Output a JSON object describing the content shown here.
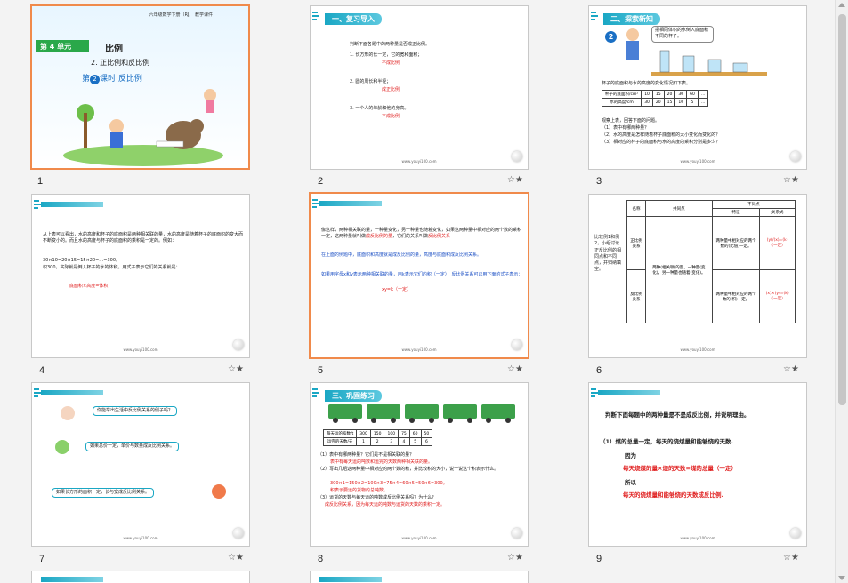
{
  "slides": [
    {
      "num": "1",
      "header": "六年级数学下册（RJ）",
      "header2": "教学课件",
      "unit": "第 4 单元",
      "unit_title": "比例",
      "lesson": "2. 正比例和反比例",
      "period_prefix": "第",
      "period_num": "2",
      "period_suffix": "课时  反比例"
    },
    {
      "num": "2",
      "title": "一、复习导入",
      "intro": "判断下面各题中的两种量是否成正比例。",
      "q1": "1. 长方形的长一定，它的宽和面积；",
      "a1": "不成比例",
      "q2": "2. 圆的周长和半径；",
      "a2": "成正比例",
      "q3": "3. 一个人的年龄和他的身高。",
      "a3": "不成比例",
      "url": "www.youyi100.com"
    },
    {
      "num": "3",
      "title": "二、探索新知",
      "badge": "2",
      "bubble": "把相同体积的水倒入底面积不同的杯子。",
      "caption": "杯子的底面积与水的高度的变化情况如下表。",
      "row1_label": "杯子的底面积/cm²",
      "row1": [
        "10",
        "15",
        "20",
        "30",
        "60",
        "…"
      ],
      "row2_label": "水的高度/cm",
      "row2": [
        "30",
        "20",
        "15",
        "10",
        "5",
        "…"
      ],
      "lead": "观察上表，回答下面的问题。",
      "questions": [
        "（1）表中有哪两种量？",
        "（2）水的高度是怎样随着杯子底面积的大小变化而变化的？",
        "（3）相对应的杯子的底面积与水的高度的乘积分别是多少？"
      ],
      "url": "www.youyi100.com"
    },
    {
      "num": "4",
      "para": "从上表可以看出，水的高度和杯子的底面积是两种相关联的量，水的高度是随着杯子的底面积的变大而不断变小的。而且水的高度与杯子的底面积的乘积是一定的。例如：",
      "calc": "30×10=20×15=15×20=…=300。",
      "para2": "积300，实际就是倒入杯子的水的体积。用式子表示它们的关系就是：",
      "formula": "底面积×高度=体积",
      "url": "www.youyi100.com"
    },
    {
      "num": "5",
      "p1": "像这样，两种相关联的量，一种量变化，另一种量也随着变化，如果这两种量中相对应的两个数的乘积一定，这两种量就叫做",
      "p1_red": "成反比例的量",
      "p1_end": "，它们的关系叫做",
      "p1_red2": "反比例关系",
      "p2": "在上面的例题中，底面积和高度就是成反比例的量，高度与底面积成反比例关系。",
      "p3": "如果用字母x和y表示两种相关联的量，用k表示它们的积（一定），反比例关系可以用下面的式子表示：",
      "formula": "xy=k（一定）",
      "url": "www.youyi100.com"
    },
    {
      "num": "6",
      "side": "比较例1和例2，小组讨论正反比例的相同点和不同点，并归纳填空。",
      "h_name": "名称",
      "h_same": "共同点",
      "h_diff": "不同点",
      "h_feat": "特征",
      "h_rel": "关系式",
      "r1_name": "正比例关系",
      "same": "两种(相关联)的量，一种量(变化)，另一种量也随着(变化)。",
      "r1_feat": "两种量中相对应的两个数的(比值)一定。",
      "r1_rel": "(y)/(x)=(k)（一定）",
      "r2_name": "反比例关系",
      "r2_feat": "两种量中相对应的两个数的(积)一定。",
      "r2_rel": "(x)×(y)=(k)（一定）",
      "url": "www.youyi100.com"
    },
    {
      "num": "7",
      "b1": "你能举出生活中反比例关系的例子吗？",
      "b2": "如果总价一定，单价与数量成反比例关系。",
      "b3": "如果长方形的面积一定，长与宽成反比例关系。",
      "url": "www.youyi100.com"
    },
    {
      "num": "8",
      "title": "三、巩固练习",
      "row1_label": "每天运的吨数/t",
      "row1": [
        "300",
        "150",
        "100",
        "75",
        "60",
        "50"
      ],
      "row2_label": "运完的天数/天",
      "row2": [
        "1",
        "2",
        "3",
        "4",
        "5",
        "6"
      ],
      "q1": "（1）表中有哪两种量？它们是不是相关联的量？",
      "a1": "表中有每天运的吨数和运完的天数两种相关联的量。",
      "q2": "（2）写出几组这两种量中相对应的两个数的积，并比较积的大小，说一说这个积表示什么。",
      "a2": "300×1=150×2=100×3=75×4=60×5=50×6=300。",
      "a2b": "积表示要运的货物的总吨数。",
      "q3": "（3）运货的天数与每天运的吨数成反比例关系吗？为什么？",
      "a3": "成反比例关系，因为每天运的吨数与运货的天数的乘积一定。",
      "url": "www.youyi100.com"
    },
    {
      "num": "9",
      "head": "判断下面每题中的两种量是不是成反比例，并说明理由。",
      "q": "（1）煤的总量一定，每天的烧煤量和能够烧的天数.",
      "because": "因为",
      "eq": "每天烧煤的量×烧的天数=煤的总量（一定）",
      "so": "所以",
      "concl": "每天的烧煤量和能够烧的天数成反比例.",
      "url": "www.youyi100.com"
    }
  ]
}
